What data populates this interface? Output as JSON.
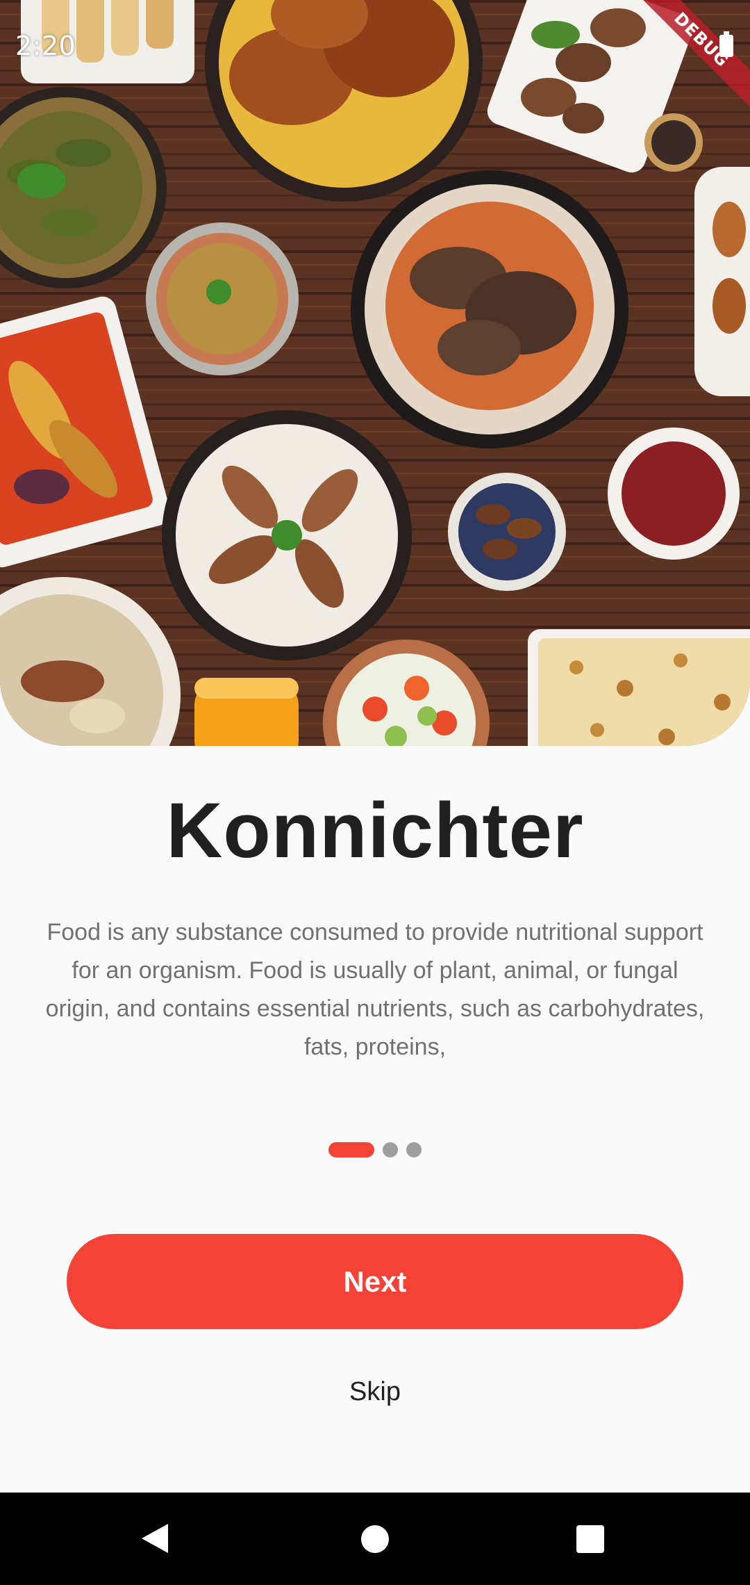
{
  "status_bar": {
    "time": "2:20",
    "battery_icon": "battery-full-icon",
    "debug_label": "DEBUG"
  },
  "hero": {
    "image": "food-spread-image",
    "description": "Top-down spread of Middle Eastern dishes on a wooden table"
  },
  "onboarding": {
    "title": "Konnichter",
    "description": "Food is any substance consumed to provide nutritional support for an organism. Food is usually of plant, animal, or fungal origin, and contains essential nutrients, such as carbohydrates, fats, proteins,",
    "page_count": 3,
    "current_page": 1,
    "next_label": "Next",
    "skip_label": "Skip"
  },
  "colors": {
    "accent": "#f44336",
    "background": "#fafafa",
    "title": "#202020",
    "body": "#707070",
    "inactive_dot": "#9e9e9e"
  },
  "nav_bar": {
    "back_icon": "back-triangle-icon",
    "home_icon": "home-circle-icon",
    "recents_icon": "recents-square-icon"
  }
}
